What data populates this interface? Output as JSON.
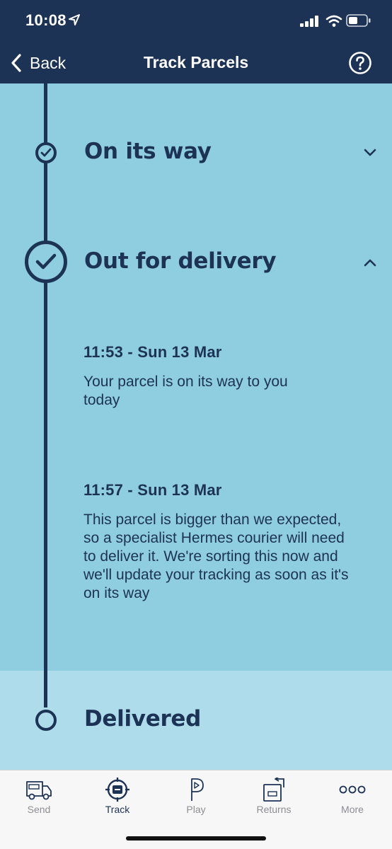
{
  "status_bar": {
    "time": "10:08"
  },
  "nav": {
    "back_label": "Back",
    "title": "Track Parcels"
  },
  "stages": [
    {
      "title": "On its way",
      "state": "complete",
      "expanded": false
    },
    {
      "title": "Out for delivery",
      "state": "complete",
      "expanded": true,
      "events": [
        {
          "time": "11:53 - Sun 13 Mar",
          "text": "Your parcel is on its way to you today"
        },
        {
          "time": "11:57 - Sun 13 Mar",
          "text": "This parcel is bigger than we expected, so a specialist Hermes courier will need to deliver it. We're sorting this now and we'll update your tracking as soon as it's on its way"
        }
      ]
    },
    {
      "title": "Delivered",
      "state": "pending"
    }
  ],
  "tabs": [
    {
      "label": "Send",
      "icon": "van-icon",
      "active": false
    },
    {
      "label": "Track",
      "icon": "track-target-icon",
      "active": true
    },
    {
      "label": "Play",
      "icon": "play-p-icon",
      "active": false
    },
    {
      "label": "Returns",
      "icon": "returns-box-icon",
      "active": false
    },
    {
      "label": "More",
      "icon": "more-dots-icon",
      "active": false
    }
  ],
  "colors": {
    "navy": "#1d3356",
    "active_bg": "#8fcde0",
    "pending_bg": "#aedcea",
    "tab_inactive": "#8e8e93"
  }
}
